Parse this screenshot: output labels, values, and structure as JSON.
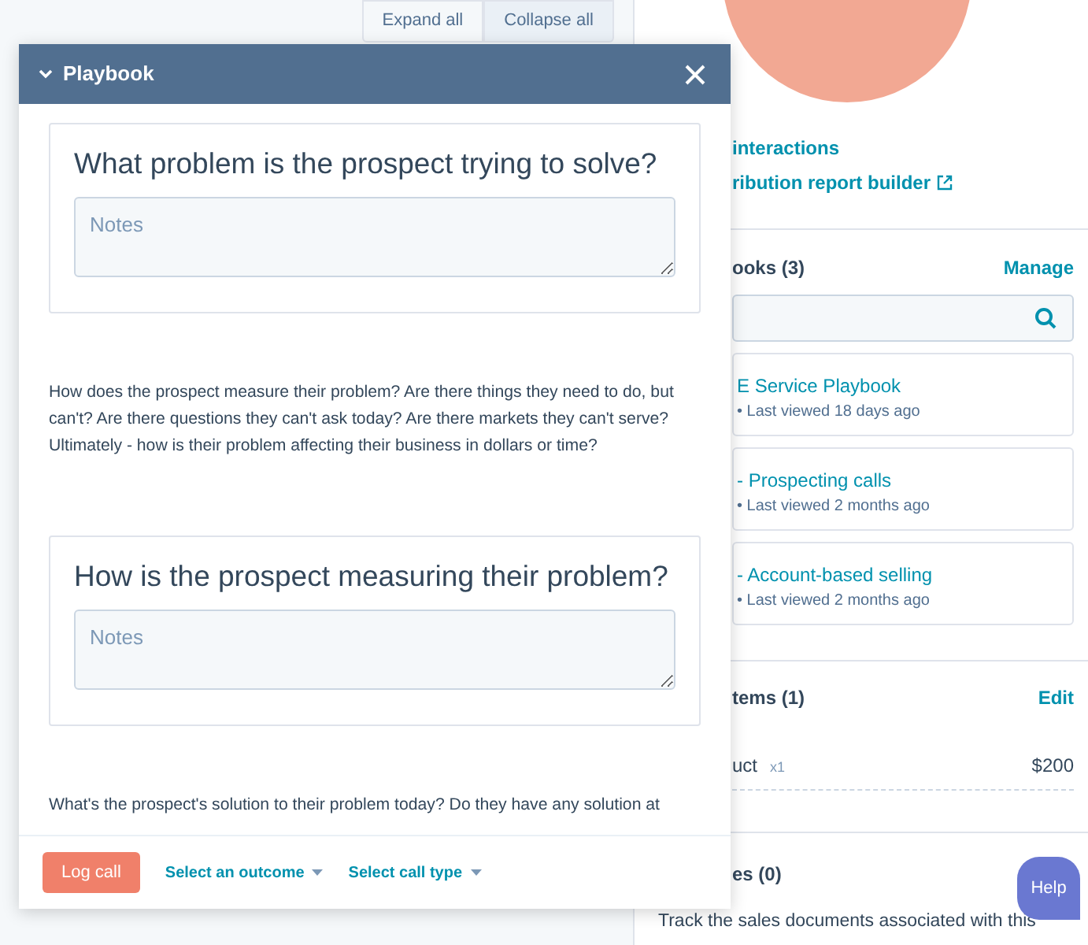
{
  "toolbar": {
    "buttons": [
      {
        "label": "Expand all",
        "selected": false
      },
      {
        "label": "Collapse all",
        "selected": true
      }
    ]
  },
  "sidebar": {
    "links": [
      {
        "label": "interactions",
        "external": false
      },
      {
        "label": "ribution report builder",
        "external": true
      }
    ],
    "playbooks": {
      "title": "ooks (3)",
      "action": "Manage",
      "items": [
        {
          "title": "E Service Playbook",
          "meta": "• Last viewed 18 days ago"
        },
        {
          "title": "- Prospecting calls",
          "meta": "• Last viewed 2 months ago"
        },
        {
          "title": "- Account-based selling",
          "meta": "• Last viewed 2 months ago"
        }
      ]
    },
    "line_items": {
      "title": "tems (1)",
      "action": "Edit",
      "items": [
        {
          "name": "uct",
          "quantity": "x1",
          "price": "$200"
        }
      ]
    },
    "quotes": {
      "title": "es (0)",
      "description": "Track the sales documents associated with this"
    }
  },
  "help_button": "Help",
  "playbook_modal": {
    "title": "Playbook",
    "expanded": true,
    "sections": [
      {
        "kind": "question",
        "title": "What problem is the prospect trying to solve?",
        "placeholder": "Notes"
      },
      {
        "kind": "text",
        "text": "How does the prospect measure their problem? Are there things they need to do, but can't? Are there questions they can't ask today? Are there markets they can't serve? Ultimately - how is their problem affecting their business in dollars or time?"
      },
      {
        "kind": "question",
        "title": "How is the prospect measuring their problem?",
        "placeholder": "Notes"
      },
      {
        "kind": "text",
        "text": "What's the prospect's solution to their problem today? Do they have any solution at"
      }
    ],
    "footer": {
      "primary": "Log call",
      "dropdowns": [
        "Select an outcome",
        "Select call type"
      ]
    }
  }
}
